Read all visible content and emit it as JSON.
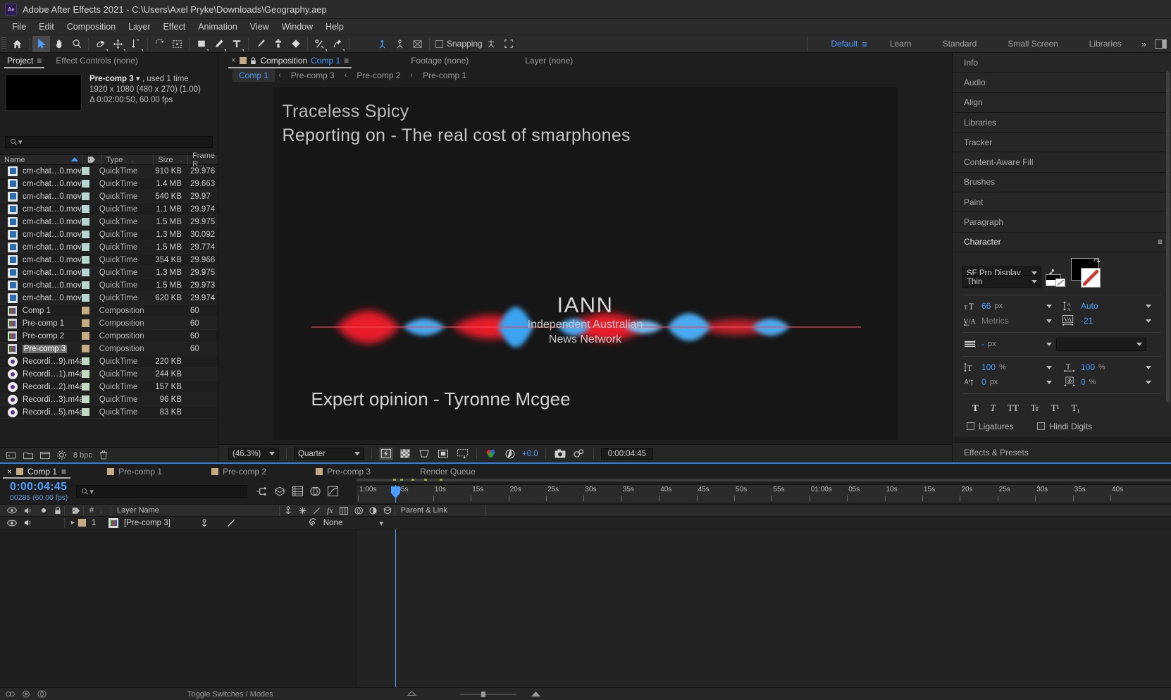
{
  "window": {
    "app_title": "Adobe After Effects 2021 - C:\\Users\\Axel Pryke\\Downloads\\Geography.aep",
    "logo": "Ae"
  },
  "menubar": [
    "File",
    "Edit",
    "Composition",
    "Layer",
    "Effect",
    "Animation",
    "View",
    "Window",
    "Help"
  ],
  "toolbar": {
    "snapping_label": "Snapping",
    "workspaces": [
      "Default",
      "Learn",
      "Standard",
      "Small Screen",
      "Libraries"
    ],
    "active_workspace": "Default"
  },
  "project_panel": {
    "tabs": [
      {
        "label": "Project",
        "active": true
      },
      {
        "label": "Effect Controls (none)",
        "active": false
      }
    ],
    "selected_item": {
      "name": "Pre-comp 3",
      "usage": ", used 1 time",
      "dimensions": "1920 x 1080  (480 x 270) (1.00)",
      "duration": "Δ 0:02:00:50, 60.00 fps"
    },
    "search_placeholder": "",
    "columns": [
      "Name",
      "Type",
      "Size",
      "Frame R..."
    ],
    "items": [
      {
        "name": "cm-chat…0.mov",
        "kind": "mov",
        "type": "QuickTime",
        "size": "910 KB",
        "framerate": "29.976",
        "selected": false
      },
      {
        "name": "cm-chat…0.mov",
        "kind": "mov",
        "type": "QuickTime",
        "size": "1.4 MB",
        "framerate": "29.663",
        "selected": false
      },
      {
        "name": "cm-chat…0.mov",
        "kind": "mov",
        "type": "QuickTime",
        "size": "540 KB",
        "framerate": "29.97",
        "selected": false
      },
      {
        "name": "cm-chat…0.mov",
        "kind": "mov",
        "type": "QuickTime",
        "size": "1.1 MB",
        "framerate": "29.974",
        "selected": false
      },
      {
        "name": "cm-chat…0.mov",
        "kind": "mov",
        "type": "QuickTime",
        "size": "1.5 MB",
        "framerate": "29.975",
        "selected": false
      },
      {
        "name": "cm-chat…0.mov",
        "kind": "mov",
        "type": "QuickTime",
        "size": "1.3 MB",
        "framerate": "30.092",
        "selected": false
      },
      {
        "name": "cm-chat…0.mov",
        "kind": "mov",
        "type": "QuickTime",
        "size": "1.5 MB",
        "framerate": "29.774",
        "selected": false
      },
      {
        "name": "cm-chat…0.mov",
        "kind": "mov",
        "type": "QuickTime",
        "size": "354 KB",
        "framerate": "29.966",
        "selected": false
      },
      {
        "name": "cm-chat…0.mov",
        "kind": "mov",
        "type": "QuickTime",
        "size": "1.3 MB",
        "framerate": "29.975",
        "selected": false
      },
      {
        "name": "cm-chat…0.mov",
        "kind": "mov",
        "type": "QuickTime",
        "size": "1.5 MB",
        "framerate": "29.973",
        "selected": false
      },
      {
        "name": "cm-chat…0.mov",
        "kind": "mov",
        "type": "QuickTime",
        "size": "620 KB",
        "framerate": "29.974",
        "selected": false
      },
      {
        "name": "Comp 1",
        "kind": "comp",
        "type": "Composition",
        "size": "",
        "framerate": "60",
        "selected": false
      },
      {
        "name": "Pre-comp 1",
        "kind": "comp",
        "type": "Composition",
        "size": "",
        "framerate": "60",
        "selected": false
      },
      {
        "name": "Pre-comp 2",
        "kind": "comp",
        "type": "Composition",
        "size": "",
        "framerate": "60",
        "selected": false
      },
      {
        "name": "Pre-comp 3",
        "kind": "comp",
        "type": "Composition",
        "size": "",
        "framerate": "60",
        "selected": true
      },
      {
        "name": "Recordi…9).m4a",
        "kind": "aud",
        "type": "QuickTime",
        "size": "220 KB",
        "framerate": "",
        "selected": false
      },
      {
        "name": "Recordi…1).m4a",
        "kind": "aud",
        "type": "QuickTime",
        "size": "244 KB",
        "framerate": "",
        "selected": false
      },
      {
        "name": "Recordi…2).m4a",
        "kind": "aud",
        "type": "QuickTime",
        "size": "157 KB",
        "framerate": "",
        "selected": false
      },
      {
        "name": "Recordi…3).m4a",
        "kind": "aud",
        "type": "QuickTime",
        "size": "96 KB",
        "framerate": "",
        "selected": false
      },
      {
        "name": "Recordi…5).m4a",
        "kind": "aud",
        "type": "QuickTime",
        "size": "83 KB",
        "framerate": "",
        "selected": false
      }
    ],
    "footer": {
      "bit_depth": "8 bpc"
    }
  },
  "comp_panel": {
    "tabs": [
      {
        "label_prefix": "Composition",
        "label_name": "Comp 1",
        "active": true
      },
      {
        "label": "Footage (none)",
        "active": false
      },
      {
        "label": "Layer (none)",
        "active": false
      }
    ],
    "breadcrumbs": [
      "Comp 1",
      "Pre-comp 3",
      "Pre-comp 2",
      "Pre-comp 1"
    ],
    "active_breadcrumb": "Comp 1",
    "canvas": {
      "title_line1": "Traceless Spicy",
      "title_line2": "Reporting on - The real cost of smarphones",
      "logo_main": "IANN",
      "logo_sub1": "Independent Australian",
      "logo_sub2": "News Network",
      "footer_text": "Expert opinion - Tyronne Mcgee"
    },
    "footer": {
      "zoom": "(46.3%)",
      "resolution": "Quarter",
      "exposure": "+0.0",
      "timecode": "0:00:04:45"
    }
  },
  "right_dock": {
    "panels": [
      "Info",
      "Audio",
      "Align",
      "Libraries",
      "Tracker",
      "Content-Aware Fill",
      "Brushes",
      "Paint",
      "Paragraph"
    ],
    "character": {
      "title": "Character",
      "font_family": "SF Pro Display",
      "font_style": "Thin",
      "font_size": "66",
      "font_size_unit": "px",
      "leading": "Auto",
      "kerning": "Metrics",
      "tracking": "-21",
      "stroke_width": "-",
      "stroke_width_unit": "px",
      "stroke_style": "",
      "vertical_scale": "100",
      "vertical_scale_unit": "%",
      "horizontal_scale": "100",
      "horizontal_scale_unit": "%",
      "baseline_shift": "0",
      "baseline_shift_unit": "px",
      "tsume": "0",
      "tsume_unit": "%",
      "style_buttons": [
        "T",
        "T",
        "TT",
        "Tr",
        "T¹",
        "T₁"
      ],
      "ligatures_label": "Ligatures",
      "hindi_label": "Hindi Digits"
    },
    "effects_presets": "Effects & Presets"
  },
  "timeline": {
    "tabs": [
      {
        "label": "Comp 1",
        "active": true
      },
      {
        "label": "Pre-comp 1",
        "active": false
      },
      {
        "label": "Pre-comp 2",
        "active": false
      },
      {
        "label": "Pre-comp 3",
        "active": false
      },
      {
        "label": "Render Queue",
        "active": false,
        "noswatch": true
      }
    ],
    "current_time": "0:00:04:45",
    "frame_info": "00285 (60.00 fps)",
    "search_placeholder": "",
    "columns": {
      "layer_name": "Layer Name",
      "parent_link": "Parent & Link",
      "number": "#"
    },
    "layers": [
      {
        "index": "1",
        "name": "[Pre-comp 3]",
        "parent": "None"
      }
    ],
    "ruler_ticks": [
      "1:00s",
      "05s",
      "10s",
      "15s",
      "20s",
      "25s",
      "30s",
      "35s",
      "40s",
      "45s",
      "50s",
      "55s",
      "01:00s",
      "05s",
      "10s",
      "15s",
      "20s",
      "25s",
      "30s",
      "35s",
      "40s"
    ],
    "footer_label": "Toggle Switches / Modes"
  }
}
